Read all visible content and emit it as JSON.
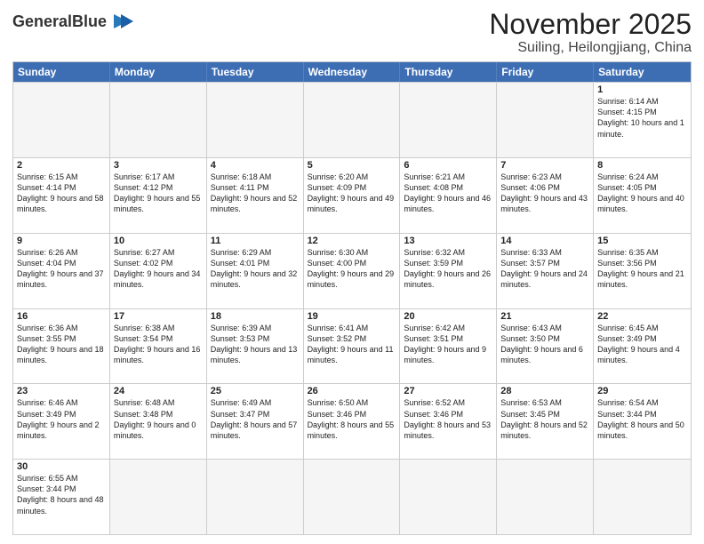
{
  "logo": {
    "text_normal": "General",
    "text_bold": "Blue"
  },
  "title": "November 2025",
  "subtitle": "Suiling, Heilongjiang, China",
  "header_days": [
    "Sunday",
    "Monday",
    "Tuesday",
    "Wednesday",
    "Thursday",
    "Friday",
    "Saturday"
  ],
  "weeks": [
    [
      {
        "day": "",
        "info": ""
      },
      {
        "day": "",
        "info": ""
      },
      {
        "day": "",
        "info": ""
      },
      {
        "day": "",
        "info": ""
      },
      {
        "day": "",
        "info": ""
      },
      {
        "day": "",
        "info": ""
      },
      {
        "day": "1",
        "info": "Sunrise: 6:14 AM\nSunset: 4:15 PM\nDaylight: 10 hours and 1 minute."
      }
    ],
    [
      {
        "day": "2",
        "info": "Sunrise: 6:15 AM\nSunset: 4:14 PM\nDaylight: 9 hours and 58 minutes."
      },
      {
        "day": "3",
        "info": "Sunrise: 6:17 AM\nSunset: 4:12 PM\nDaylight: 9 hours and 55 minutes."
      },
      {
        "day": "4",
        "info": "Sunrise: 6:18 AM\nSunset: 4:11 PM\nDaylight: 9 hours and 52 minutes."
      },
      {
        "day": "5",
        "info": "Sunrise: 6:20 AM\nSunset: 4:09 PM\nDaylight: 9 hours and 49 minutes."
      },
      {
        "day": "6",
        "info": "Sunrise: 6:21 AM\nSunset: 4:08 PM\nDaylight: 9 hours and 46 minutes."
      },
      {
        "day": "7",
        "info": "Sunrise: 6:23 AM\nSunset: 4:06 PM\nDaylight: 9 hours and 43 minutes."
      },
      {
        "day": "8",
        "info": "Sunrise: 6:24 AM\nSunset: 4:05 PM\nDaylight: 9 hours and 40 minutes."
      }
    ],
    [
      {
        "day": "9",
        "info": "Sunrise: 6:26 AM\nSunset: 4:04 PM\nDaylight: 9 hours and 37 minutes."
      },
      {
        "day": "10",
        "info": "Sunrise: 6:27 AM\nSunset: 4:02 PM\nDaylight: 9 hours and 34 minutes."
      },
      {
        "day": "11",
        "info": "Sunrise: 6:29 AM\nSunset: 4:01 PM\nDaylight: 9 hours and 32 minutes."
      },
      {
        "day": "12",
        "info": "Sunrise: 6:30 AM\nSunset: 4:00 PM\nDaylight: 9 hours and 29 minutes."
      },
      {
        "day": "13",
        "info": "Sunrise: 6:32 AM\nSunset: 3:59 PM\nDaylight: 9 hours and 26 minutes."
      },
      {
        "day": "14",
        "info": "Sunrise: 6:33 AM\nSunset: 3:57 PM\nDaylight: 9 hours and 24 minutes."
      },
      {
        "day": "15",
        "info": "Sunrise: 6:35 AM\nSunset: 3:56 PM\nDaylight: 9 hours and 21 minutes."
      }
    ],
    [
      {
        "day": "16",
        "info": "Sunrise: 6:36 AM\nSunset: 3:55 PM\nDaylight: 9 hours and 18 minutes."
      },
      {
        "day": "17",
        "info": "Sunrise: 6:38 AM\nSunset: 3:54 PM\nDaylight: 9 hours and 16 minutes."
      },
      {
        "day": "18",
        "info": "Sunrise: 6:39 AM\nSunset: 3:53 PM\nDaylight: 9 hours and 13 minutes."
      },
      {
        "day": "19",
        "info": "Sunrise: 6:41 AM\nSunset: 3:52 PM\nDaylight: 9 hours and 11 minutes."
      },
      {
        "day": "20",
        "info": "Sunrise: 6:42 AM\nSunset: 3:51 PM\nDaylight: 9 hours and 9 minutes."
      },
      {
        "day": "21",
        "info": "Sunrise: 6:43 AM\nSunset: 3:50 PM\nDaylight: 9 hours and 6 minutes."
      },
      {
        "day": "22",
        "info": "Sunrise: 6:45 AM\nSunset: 3:49 PM\nDaylight: 9 hours and 4 minutes."
      }
    ],
    [
      {
        "day": "23",
        "info": "Sunrise: 6:46 AM\nSunset: 3:49 PM\nDaylight: 9 hours and 2 minutes."
      },
      {
        "day": "24",
        "info": "Sunrise: 6:48 AM\nSunset: 3:48 PM\nDaylight: 9 hours and 0 minutes."
      },
      {
        "day": "25",
        "info": "Sunrise: 6:49 AM\nSunset: 3:47 PM\nDaylight: 8 hours and 57 minutes."
      },
      {
        "day": "26",
        "info": "Sunrise: 6:50 AM\nSunset: 3:46 PM\nDaylight: 8 hours and 55 minutes."
      },
      {
        "day": "27",
        "info": "Sunrise: 6:52 AM\nSunset: 3:46 PM\nDaylight: 8 hours and 53 minutes."
      },
      {
        "day": "28",
        "info": "Sunrise: 6:53 AM\nSunset: 3:45 PM\nDaylight: 8 hours and 52 minutes."
      },
      {
        "day": "29",
        "info": "Sunrise: 6:54 AM\nSunset: 3:44 PM\nDaylight: 8 hours and 50 minutes."
      }
    ],
    [
      {
        "day": "30",
        "info": "Sunrise: 6:55 AM\nSunset: 3:44 PM\nDaylight: 8 hours and 48 minutes."
      },
      {
        "day": "",
        "info": ""
      },
      {
        "day": "",
        "info": ""
      },
      {
        "day": "",
        "info": ""
      },
      {
        "day": "",
        "info": ""
      },
      {
        "day": "",
        "info": ""
      },
      {
        "day": "",
        "info": ""
      }
    ]
  ]
}
